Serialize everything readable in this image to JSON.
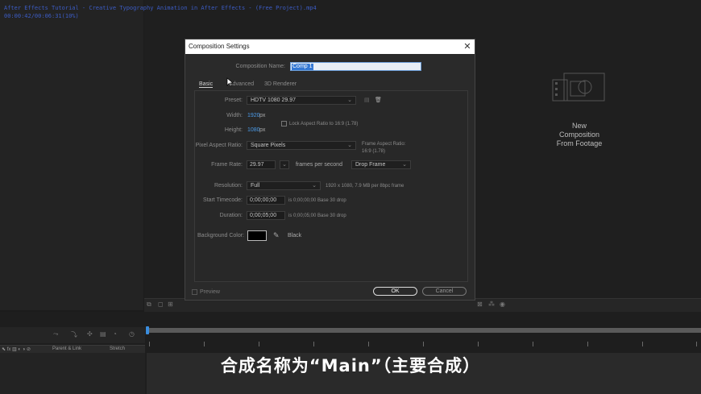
{
  "window": {
    "title": "After Effects Tutorial - Creative Typography Animation in After Effects - (Free Project).mp4",
    "timecode": "00:00:42/00:06:31(10%)"
  },
  "viewer": {
    "new_comp_lines": [
      "New",
      "Composition",
      "From Footage"
    ]
  },
  "dialog": {
    "title": "Composition Settings",
    "close_glyph": "✕",
    "comp_name_label": "Composition Name:",
    "comp_name_value": "Comp 1",
    "tabs": [
      "Basic",
      "Advanced",
      "3D Renderer"
    ],
    "preset_label": "Preset:",
    "preset_value": "HDTV 1080 29.97",
    "width_label": "Width:",
    "width_value": "1920",
    "height_label": "Height:",
    "height_value": "1080",
    "px_unit": "px",
    "lock_aspect_label": "Lock Aspect Ratio to 16:9 (1.78)",
    "par_label": "Pixel Aspect Ratio:",
    "par_value": "Square Pixels",
    "frame_aspect_label": "Frame Aspect Ratio:",
    "frame_aspect_value": "16:9 (1.78)",
    "frame_rate_label": "Frame Rate:",
    "frame_rate_value": "29.97",
    "fps_label": "frames per second",
    "drop_frame_value": "Drop Frame",
    "resolution_label": "Resolution:",
    "resolution_value": "Full",
    "resolution_info": "1920 x 1080, 7.9 MB per 8bpc frame",
    "start_tc_label": "Start Timecode:",
    "start_tc_value": "0;00;00;00",
    "start_tc_info": "is 0;00;00;00  Base 30  drop",
    "duration_label": "Duration:",
    "duration_value": "0;00;05;00",
    "duration_info": "is 0;00;05;00  Base 30  drop",
    "bg_color_label": "Background Color:",
    "bg_color_name": "Black",
    "bg_color_hex": "#000000",
    "preview_label": "Preview",
    "ok_label": "OK",
    "cancel_label": "Cancel"
  },
  "timeline": {
    "parent_link_label": "Parent & Link",
    "stretch_label": "Stretch"
  },
  "subtitle": "合成名称为“Main”（主要合成）",
  "colors": {
    "accent_blue": "#4a9ae8",
    "selection_blue": "#3478d4"
  }
}
